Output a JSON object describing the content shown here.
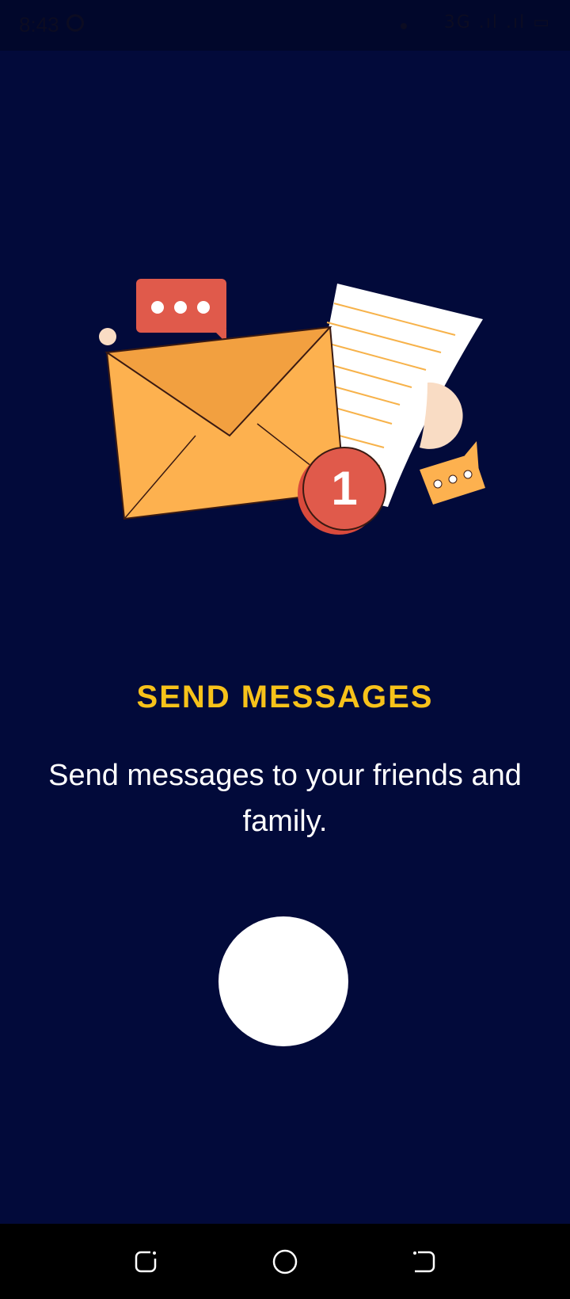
{
  "status_bar": {
    "time": "8:43",
    "right_text": "3G .ıl .ıl ▭"
  },
  "onboarding": {
    "title": "SEND MESSAGES",
    "subtitle": "Send messages to your friends and family.",
    "badge_number": "1"
  },
  "colors": {
    "background": "#020a3a",
    "title": "#f7c21a",
    "envelope": "#fdb14f",
    "bubble_red": "#e05a4b",
    "paper_line": "#f7b24a"
  },
  "nav": {
    "recents_icon": "recents-icon",
    "home_icon": "home-icon",
    "back_icon": "back-icon"
  }
}
